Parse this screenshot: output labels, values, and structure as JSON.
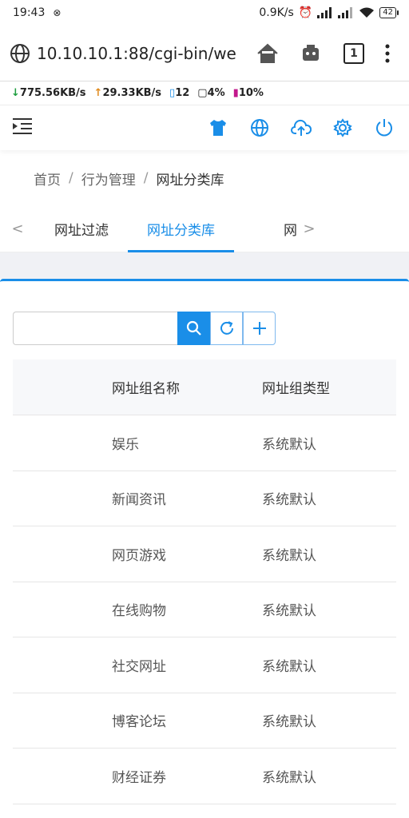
{
  "status_bar": {
    "time": "19:43",
    "speed": "0.9K/s",
    "battery": "42"
  },
  "browser": {
    "url": "10.10.10.1:88/cgi-bin/web",
    "tab_count": "1"
  },
  "net_stats": {
    "download": "775.56KB/s",
    "upload": "29.33KB/s",
    "connections": "12",
    "cpu": "4%",
    "memory": "10%"
  },
  "breadcrumb": {
    "home": "首页",
    "section": "行为管理",
    "current": "网址分类库",
    "separator": "/"
  },
  "tabs": [
    {
      "label": "网址过滤",
      "active": false
    },
    {
      "label": "网址分类库",
      "active": true
    },
    {
      "label": "网",
      "active": false
    }
  ],
  "colors": {
    "accent": "#1a8ee8",
    "download": "#1e9e3e",
    "upload": "#e08a1c"
  },
  "search": {
    "placeholder": "",
    "value": ""
  },
  "table": {
    "headers": [
      "网址组名称",
      "网址组类型"
    ],
    "rows": [
      [
        "娱乐",
        "系统默认"
      ],
      [
        "新闻资讯",
        "系统默认"
      ],
      [
        "网页游戏",
        "系统默认"
      ],
      [
        "在线购物",
        "系统默认"
      ],
      [
        "社交网址",
        "系统默认"
      ],
      [
        "博客论坛",
        "系统默认"
      ],
      [
        "财经证券",
        "系统默认"
      ]
    ]
  }
}
